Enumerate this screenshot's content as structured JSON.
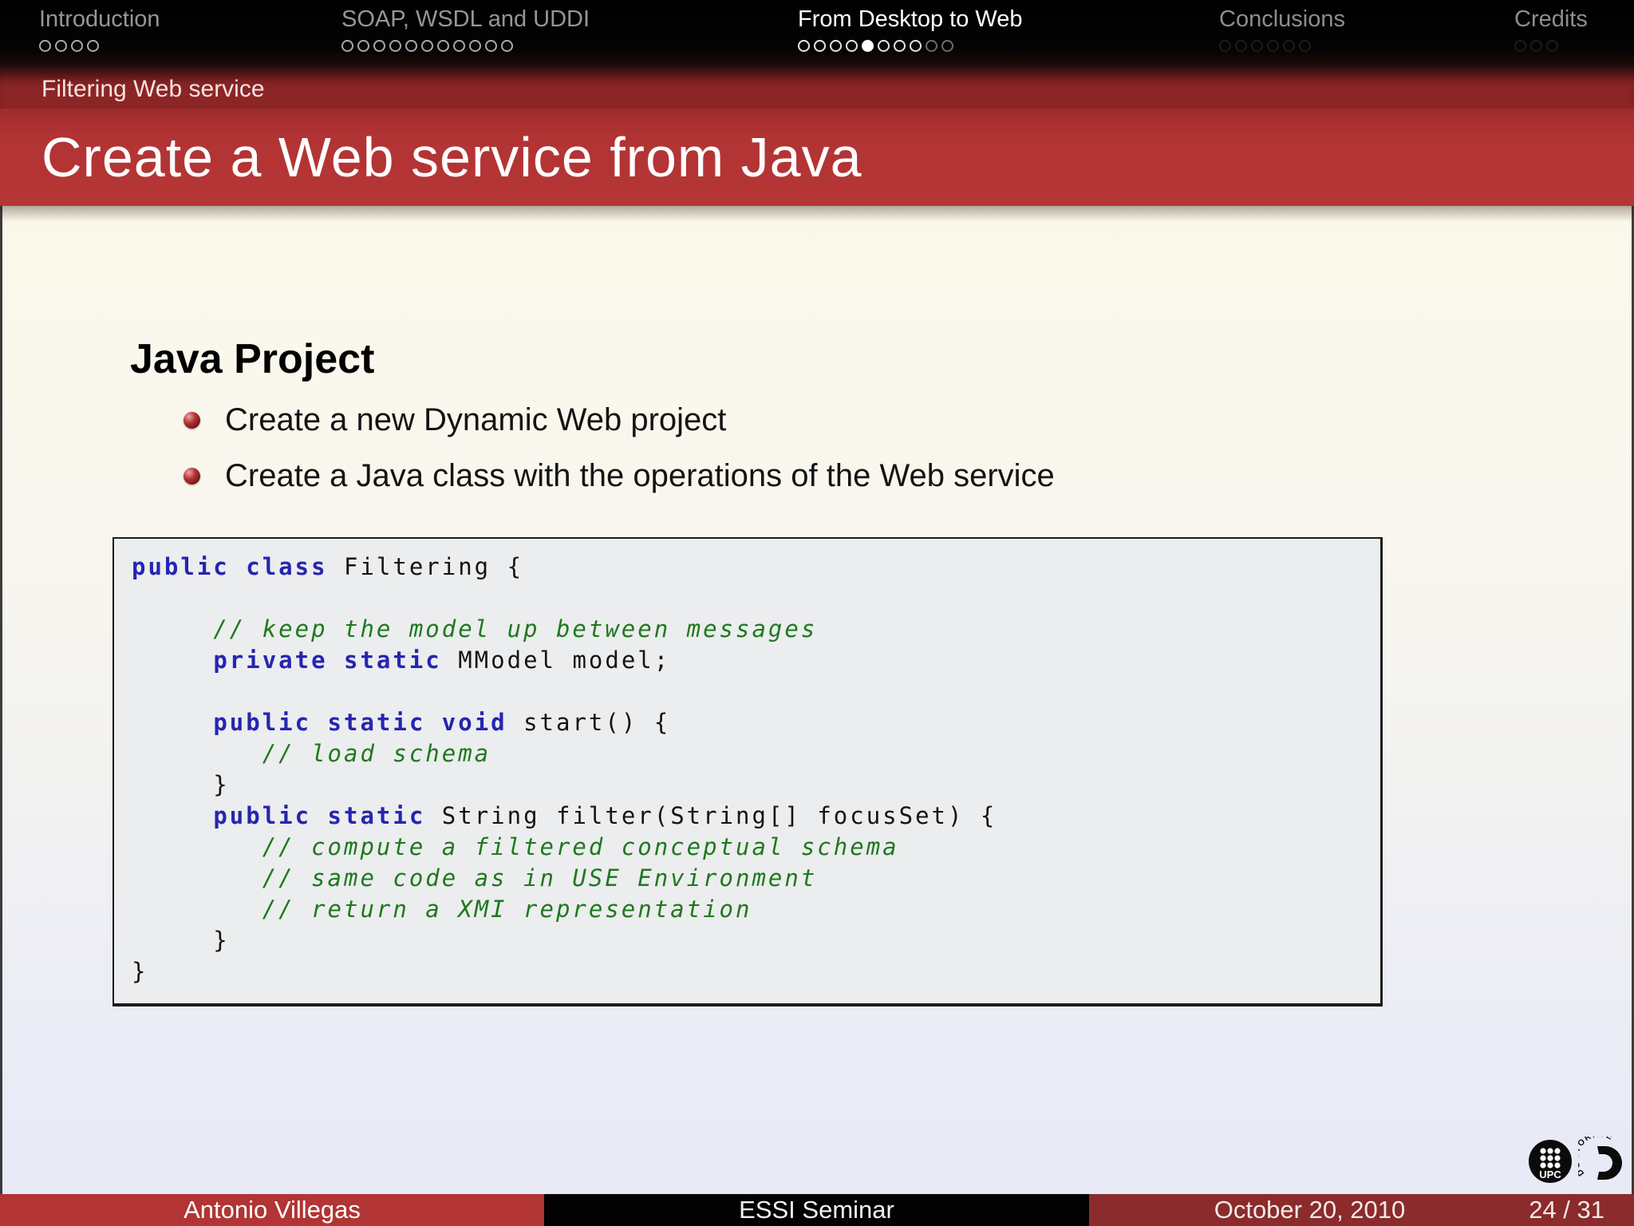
{
  "nav": {
    "sections": [
      {
        "id": "introduction",
        "label": "Introduction",
        "state": "past",
        "dots": 4,
        "filled_dot": null,
        "dim_from": null
      },
      {
        "id": "soap-wsdl-uddi",
        "label": "SOAP, WSDL and UDDI",
        "state": "past",
        "dots": 11,
        "filled_dot": null,
        "dim_from": null
      },
      {
        "id": "from-desktop-to-web",
        "label": "From Desktop to Web",
        "state": "current",
        "dots": 10,
        "filled_dot": 5,
        "dim_from": 9
      },
      {
        "id": "conclusions",
        "label": "Conclusions",
        "state": "future",
        "dots": 6,
        "filled_dot": null,
        "dim_from": null
      },
      {
        "id": "credits",
        "label": "Credits",
        "state": "future",
        "dots": 3,
        "filled_dot": null,
        "dim_from": null
      }
    ]
  },
  "header": {
    "subtitle": "Filtering Web service",
    "title": "Create a Web service from Java"
  },
  "body": {
    "heading": "Java Project",
    "bullets": [
      "Create a new Dynamic Web project",
      "Create a Java class with the operations of the Web service"
    ]
  },
  "code": {
    "language": "java",
    "lines": [
      [
        [
          "k",
          "public"
        ],
        [
          "p",
          " "
        ],
        [
          "k",
          "class"
        ],
        [
          "p",
          " Filtering {"
        ]
      ],
      [],
      [
        [
          "p",
          "     "
        ],
        [
          "c",
          "// keep the model up between messages"
        ]
      ],
      [
        [
          "p",
          "     "
        ],
        [
          "k",
          "private"
        ],
        [
          "p",
          " "
        ],
        [
          "k",
          "static"
        ],
        [
          "p",
          " MModel model;"
        ]
      ],
      [],
      [
        [
          "p",
          "     "
        ],
        [
          "k",
          "public"
        ],
        [
          "p",
          " "
        ],
        [
          "k",
          "static"
        ],
        [
          "p",
          " "
        ],
        [
          "k",
          "void"
        ],
        [
          "p",
          " start() {"
        ]
      ],
      [
        [
          "p",
          "        "
        ],
        [
          "c",
          "// load schema"
        ]
      ],
      [
        [
          "p",
          "     }"
        ]
      ],
      [
        [
          "p",
          "     "
        ],
        [
          "k",
          "public"
        ],
        [
          "p",
          " "
        ],
        [
          "k",
          "static"
        ],
        [
          "p",
          " String filter(String[] focusSet) {"
        ]
      ],
      [
        [
          "p",
          "        "
        ],
        [
          "c",
          "// compute a filtered conceptual schema"
        ]
      ],
      [
        [
          "p",
          "        "
        ],
        [
          "c",
          "// same code as in USE Environment"
        ]
      ],
      [
        [
          "p",
          "        "
        ],
        [
          "c",
          "// return a XMI representation"
        ]
      ],
      [
        [
          "p",
          "     }"
        ]
      ],
      [
        [
          "p",
          "}"
        ]
      ]
    ]
  },
  "footer": {
    "author": "Antonio Villegas",
    "event": "ESSI Seminar",
    "date": "October 20, 2010",
    "page": "24 / 31"
  },
  "logos": {
    "upc_label": "UPC",
    "doctorate_label": "DOCTORATE"
  },
  "colors": {
    "title_bar": "#b43434",
    "subtitle_bar": "#8c2525",
    "footer_author_bg": "#b23434",
    "footer_event_bg": "#020202",
    "footer_date_bg": "#8b2b2b",
    "keyword_blue": "#2525b2",
    "comment_green": "#1e791e",
    "code_background": "#ecedee",
    "bullet_ball_red": "#8b2020",
    "body_gradient_top": "#fcfae6",
    "body_gradient_bottom": "#e7e9f7"
  }
}
